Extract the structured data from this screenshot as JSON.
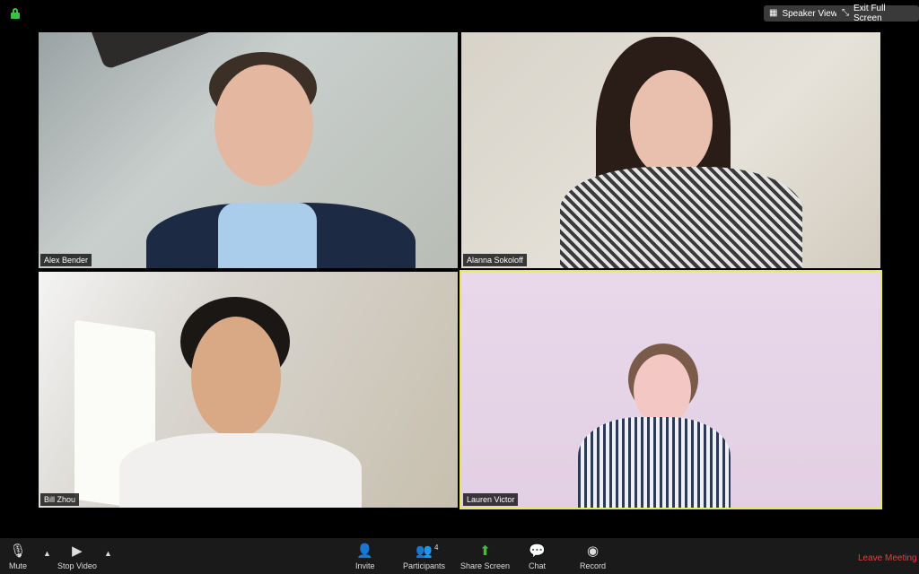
{
  "top_bar": {
    "speaker_view": {
      "label": "Speaker View",
      "icon": "speaker-view-icon"
    },
    "exit_full_screen": {
      "label": "Exit Full Screen",
      "icon": "exit-fullscreen-icon"
    },
    "lock_color": "#3fbf3f"
  },
  "participants": [
    {
      "name": "Alex Bender"
    },
    {
      "name": "Alanna Sokoloff"
    },
    {
      "name": "Bill Zhou"
    },
    {
      "name": "Lauren Victor",
      "active_speaker": true
    }
  ],
  "toolbar": {
    "mute": "Mute",
    "stop_video": "Stop Video",
    "invite": "Invite",
    "participants": "Participants",
    "participants_count": "4",
    "share_screen": "Share Screen",
    "chat": "Chat",
    "record": "Record",
    "leave": "Leave Meeting",
    "share_color": "#3fbf3f",
    "leave_color": "#e04040"
  }
}
